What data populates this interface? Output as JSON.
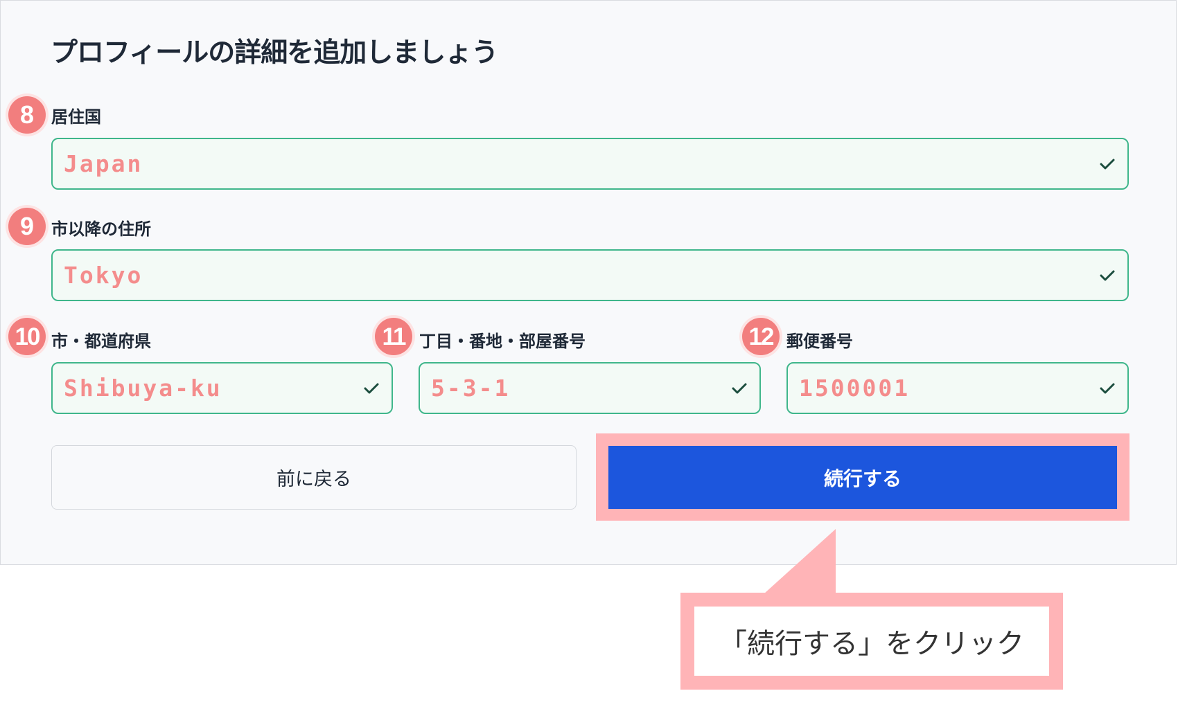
{
  "form": {
    "title": "プロフィールの詳細を追加しましょう",
    "fields": [
      {
        "step": "8",
        "label": "居住国",
        "value": "Japan"
      },
      {
        "step": "9",
        "label": "市以降の住所",
        "value": "Tokyo"
      },
      {
        "step": "10",
        "label": "市・都道府県",
        "value": "Shibuya-ku"
      },
      {
        "step": "11",
        "label": "丁目・番地・部屋番号",
        "value": "5-3-1"
      },
      {
        "step": "12",
        "label": "郵便番号",
        "value": "1500001"
      }
    ],
    "back_label": "前に戻る",
    "continue_label": "続行する"
  },
  "callout": {
    "text": "「続行する」をクリック"
  },
  "colors": {
    "accent_blue": "#1c56dd",
    "valid_green": "#3fb68b",
    "annotation_pink": "#ffb4b7",
    "badge_red": "#f27e7e",
    "value_text": "#f48c8c"
  },
  "icons": {
    "field_status": "check-icon"
  }
}
